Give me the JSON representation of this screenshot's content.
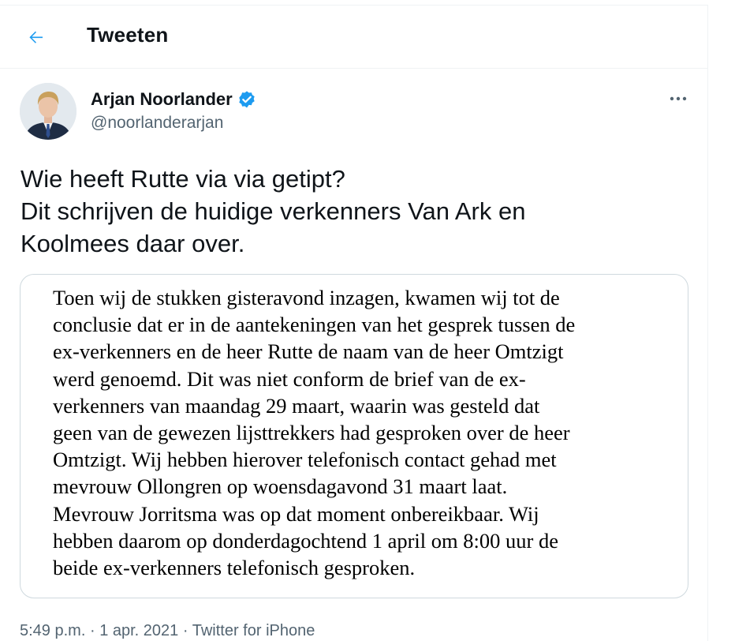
{
  "header": {
    "title": "Tweeten"
  },
  "tweet": {
    "author": {
      "name": "Arjan Noorlander",
      "handle": "@noorlanderarjan",
      "verified": true
    },
    "text_lines": [
      "Wie heeft Rutte via via getipt?",
      "Dit schrijven de huidige verkenners Van Ark en",
      "Koolmees daar over."
    ],
    "image_text_lines": [
      "Toen wij de stukken gisteravond inzagen, kwamen wij tot de",
      "conclusie dat er in de aantekeningen van het gesprek tussen de",
      "ex-verkenners en de heer Rutte de naam van de heer Omtzigt",
      "werd genoemd. Dit was niet conform de brief van de ex-",
      "verkenners van maandag 29 maart, waarin was gesteld dat",
      "geen van de gewezen lijsttrekkers had gesproken over de heer",
      "Omtzigt. Wij hebben hierover telefonisch contact gehad met",
      "mevrouw Ollongren op woensdagavond 31 maart laat.",
      "Mevrouw Jorritsma was op dat moment onbereikbaar. Wij",
      "hebben daarom op donderdagochtend 1 april om 8:00 uur de",
      "beide ex-verkenners telefonisch gesproken."
    ],
    "meta": {
      "time": "5:49 p.m.",
      "separator": "·",
      "date": "1 apr. 2021",
      "source": "Twitter for iPhone"
    }
  },
  "icons": {
    "back": "arrow-left-icon",
    "verified": "verified-badge-icon",
    "more": "more-horizontal-icon"
  },
  "colors": {
    "accent": "#1d9bf0",
    "text": "#0f1419",
    "secondary": "#536471",
    "border": "#cfd9de"
  }
}
